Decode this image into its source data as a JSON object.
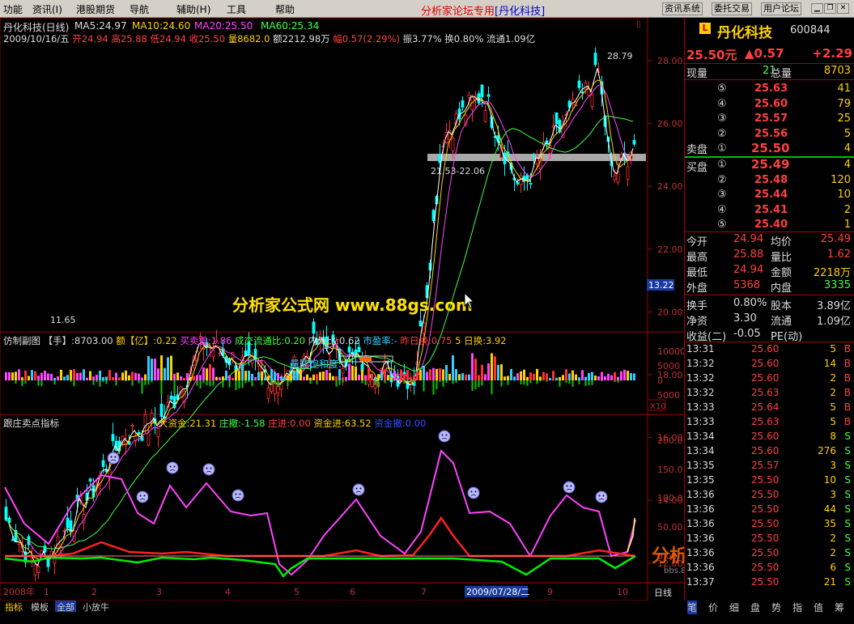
{
  "menu": {
    "items": [
      "功能",
      "资讯(I)",
      "港股期货",
      "导航",
      "辅助(H)",
      "工具",
      "帮助"
    ],
    "title": "分析家论坛专用",
    "subtitle": "[丹化科技]",
    "buttons": [
      "资讯系统",
      "委托交易",
      "用户论坛"
    ]
  },
  "main_chart": {
    "title": "丹化科技(日线)",
    "ma5": "MA5:24.97",
    "ma10": "MA10:24.60",
    "ma20": "MA20:25.50",
    "ma60": "MA60:25.34",
    "info_date": "2009/10/16/五",
    "info_open": "开24.94",
    "info_high": "高25.88",
    "info_low": "低24.94",
    "info_close": "收25.50",
    "info_vol": "量8682.0",
    "info_amount": "额2212.98万",
    "info_range": "幅0.57(2.29%)",
    "info_rest": "振3.77% 换0.80% 流通1.09亿",
    "y_ticks": [
      "28.00",
      "26.00",
      "24.00",
      "22.00",
      "20.00",
      "18.00",
      "16.00",
      "14.00",
      "12.00"
    ],
    "current_price_tag": "13.22",
    "annotation_high": "28.79",
    "annotation_low": "11.65",
    "annotation_gap": "21.53-22.06",
    "watermark": "分析家公式网 www.88gs.com"
  },
  "sub_chart1": {
    "title": "仿制副图",
    "vol": "【手】:8703.00",
    "amount": "额【亿】:0.22",
    "buy_diff": "买卖差:1.86",
    "turnover_ratio": "成交流通比:0.20",
    "inout_ratio": "内外比:0.62",
    "pe": "市盈率:-",
    "yday_turn": "昨日换:0.75",
    "turn5": "5 日换:3.92",
    "label_sat": "量能饱和度:",
    "y_ticks": [
      "10000",
      "5000",
      "0",
      "5000"
    ],
    "scale_tag": "X10"
  },
  "sub_chart2": {
    "title": "跟庄卖点指标",
    "big_money": "大资金:21.31",
    "zhuang_out": "庄撤:-1.58",
    "zhuang_in": "庄进:0.00",
    "money_in": "资金进:63.52",
    "money_out": "资金撤:0.00",
    "y_ticks": [
      "200.0",
      "150.0",
      "100.0",
      "50.00",
      "0.00"
    ],
    "watermark": "分析家论坛",
    "watermark_url": "bbs.88gs.com"
  },
  "x_axis": {
    "labels": [
      "2008年",
      "1",
      "2",
      "3",
      "4",
      "5",
      "6",
      "7",
      "9",
      "10"
    ],
    "cursor_date": "2009/07/28/二",
    "period": "日线"
  },
  "bottom_tabs": [
    "指标",
    "模板",
    "全部",
    "小放牛"
  ],
  "quote": {
    "name": "丹化科技",
    "code": "600844",
    "price": "25.50元",
    "change": "▲0.57",
    "change_pct": "+2.29",
    "now_vol_label": "现量",
    "now_vol": "21",
    "total_vol_label": "总量",
    "total_vol": "8703",
    "sell_label": "卖盘",
    "buy_label": "买盘",
    "sells": [
      {
        "lvl": "⑤",
        "price": "25.63",
        "vol": "41"
      },
      {
        "lvl": "④",
        "price": "25.60",
        "vol": "79"
      },
      {
        "lvl": "③",
        "price": "25.57",
        "vol": "25"
      },
      {
        "lvl": "②",
        "price": "25.56",
        "vol": "5"
      },
      {
        "lvl": "①",
        "price": "25.50",
        "vol": "4"
      }
    ],
    "buys": [
      {
        "lvl": "①",
        "price": "25.49",
        "vol": "4"
      },
      {
        "lvl": "②",
        "price": "25.48",
        "vol": "120"
      },
      {
        "lvl": "③",
        "price": "25.44",
        "vol": "10"
      },
      {
        "lvl": "④",
        "price": "25.41",
        "vol": "2"
      },
      {
        "lvl": "⑤",
        "price": "25.40",
        "vol": "1"
      }
    ],
    "stats": [
      {
        "l1": "今开",
        "v1": "24.94",
        "l2": "均价",
        "v2": "25.49"
      },
      {
        "l1": "最高",
        "v1": "25.88",
        "l2": "量比",
        "v2": "1.62"
      },
      {
        "l1": "最低",
        "v1": "24.94",
        "l2": "金额",
        "v2": "2218万"
      },
      {
        "l1": "外盘",
        "v1": "5368",
        "l2": "内盘",
        "v2": "3335"
      }
    ],
    "stats2": [
      {
        "l1": "换手",
        "v1": "0.80%",
        "l2": "股本",
        "v2": "3.89亿"
      },
      {
        "l1": "净资",
        "v1": "3.30",
        "l2": "流通",
        "v2": "1.09亿"
      },
      {
        "l1": "收益(二)",
        "v1": "-0.05",
        "l2": "PE(动)",
        "v2": ""
      }
    ],
    "ticks": [
      {
        "time": "13:31",
        "price": "25.60",
        "vol": "5",
        "side": "B"
      },
      {
        "time": "13:32",
        "price": "25.60",
        "vol": "14",
        "side": "B"
      },
      {
        "time": "13:32",
        "price": "25.60",
        "vol": "2",
        "side": "B"
      },
      {
        "time": "13:32",
        "price": "25.63",
        "vol": "2",
        "side": "B"
      },
      {
        "time": "13:33",
        "price": "25.64",
        "vol": "5",
        "side": "B"
      },
      {
        "time": "13:33",
        "price": "25.63",
        "vol": "5",
        "side": "B"
      },
      {
        "time": "13:34",
        "price": "25.60",
        "vol": "8",
        "side": "S"
      },
      {
        "time": "13:34",
        "price": "25.60",
        "vol": "276",
        "side": "S"
      },
      {
        "time": "13:35",
        "price": "25.57",
        "vol": "3",
        "side": "S"
      },
      {
        "time": "13:35",
        "price": "25.50",
        "vol": "10",
        "side": "S"
      },
      {
        "time": "13:36",
        "price": "25.50",
        "vol": "3",
        "side": "S"
      },
      {
        "time": "13:36",
        "price": "25.50",
        "vol": "44",
        "side": "S"
      },
      {
        "time": "13:36",
        "price": "25.50",
        "vol": "35",
        "side": "S"
      },
      {
        "time": "13:36",
        "price": "25.50",
        "vol": "2",
        "side": "S"
      },
      {
        "time": "13:36",
        "price": "25.50",
        "vol": "2",
        "side": "S"
      },
      {
        "time": "13:36",
        "price": "25.50",
        "vol": "6",
        "side": "S"
      },
      {
        "time": "13:37",
        "price": "25.50",
        "vol": "21",
        "side": "S"
      }
    ],
    "right_tabs": [
      "笔",
      "价",
      "细",
      "盘",
      "势",
      "指",
      "值",
      "筹"
    ]
  }
}
